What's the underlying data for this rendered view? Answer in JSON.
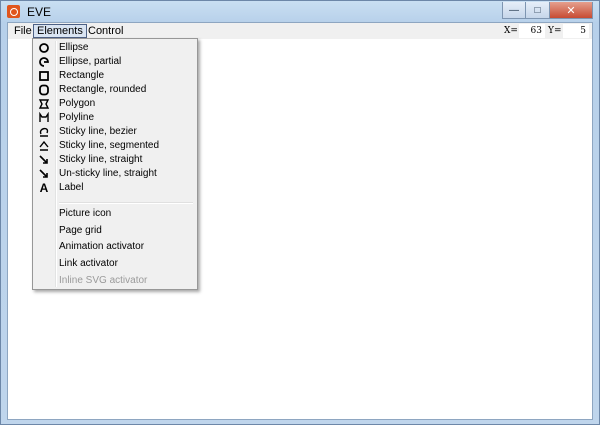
{
  "window": {
    "title": "EVE"
  },
  "menubar": {
    "items": [
      "File",
      "Elements",
      "Control"
    ],
    "coords": {
      "x_label": "X=",
      "x_value": "63",
      "y_label": "Y=",
      "y_value": "5"
    }
  },
  "elements_menu": {
    "group1": [
      {
        "label": "Ellipse",
        "icon": "ellipse-icon"
      },
      {
        "label": "Ellipse, partial",
        "icon": "ellipse-partial-icon"
      },
      {
        "label": "Rectangle",
        "icon": "rectangle-icon"
      },
      {
        "label": "Rectangle, rounded",
        "icon": "rectangle-rounded-icon"
      },
      {
        "label": "Polygon",
        "icon": "polygon-icon"
      },
      {
        "label": "Polyline",
        "icon": "polyline-icon"
      },
      {
        "label": "Sticky line, bezier",
        "icon": "bezier-line-icon"
      },
      {
        "label": "Sticky line, segmented",
        "icon": "segmented-line-icon"
      },
      {
        "label": "Sticky line, straight",
        "icon": "straight-line-icon"
      },
      {
        "label": "Un-sticky line, straight",
        "icon": "unsticky-line-icon"
      },
      {
        "label": "Label",
        "icon": "label-icon"
      }
    ],
    "group2": [
      {
        "label": "Picture icon"
      },
      {
        "label": "Page grid"
      },
      {
        "label": "Animation activator"
      },
      {
        "label": "Link activator"
      },
      {
        "label": "Inline SVG activator",
        "disabled": true
      }
    ]
  }
}
